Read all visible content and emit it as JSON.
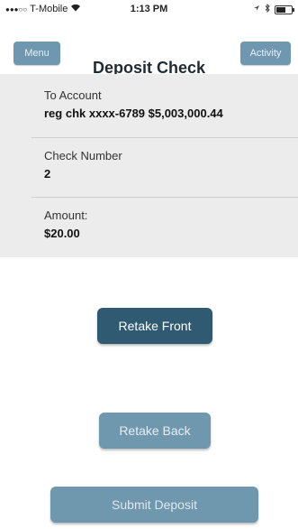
{
  "status_bar": {
    "carrier": "T-Mobile",
    "time": "1:13 PM",
    "signal_dots": "●●●○○",
    "battery_level": 0.6
  },
  "nav": {
    "menu_label": "Menu",
    "title": "Deposit Check",
    "activity_label": "Activity"
  },
  "form": {
    "to_account_label": "To Account",
    "to_account_value": "reg chk xxxx-6789 $5,003,000.44",
    "check_number_label": "Check Number",
    "check_number_value": "2",
    "amount_label": "Amount:",
    "amount_value": "$20.00"
  },
  "actions": {
    "retake_front": "Retake Front",
    "retake_back": "Retake Back",
    "submit": "Submit Deposit"
  }
}
